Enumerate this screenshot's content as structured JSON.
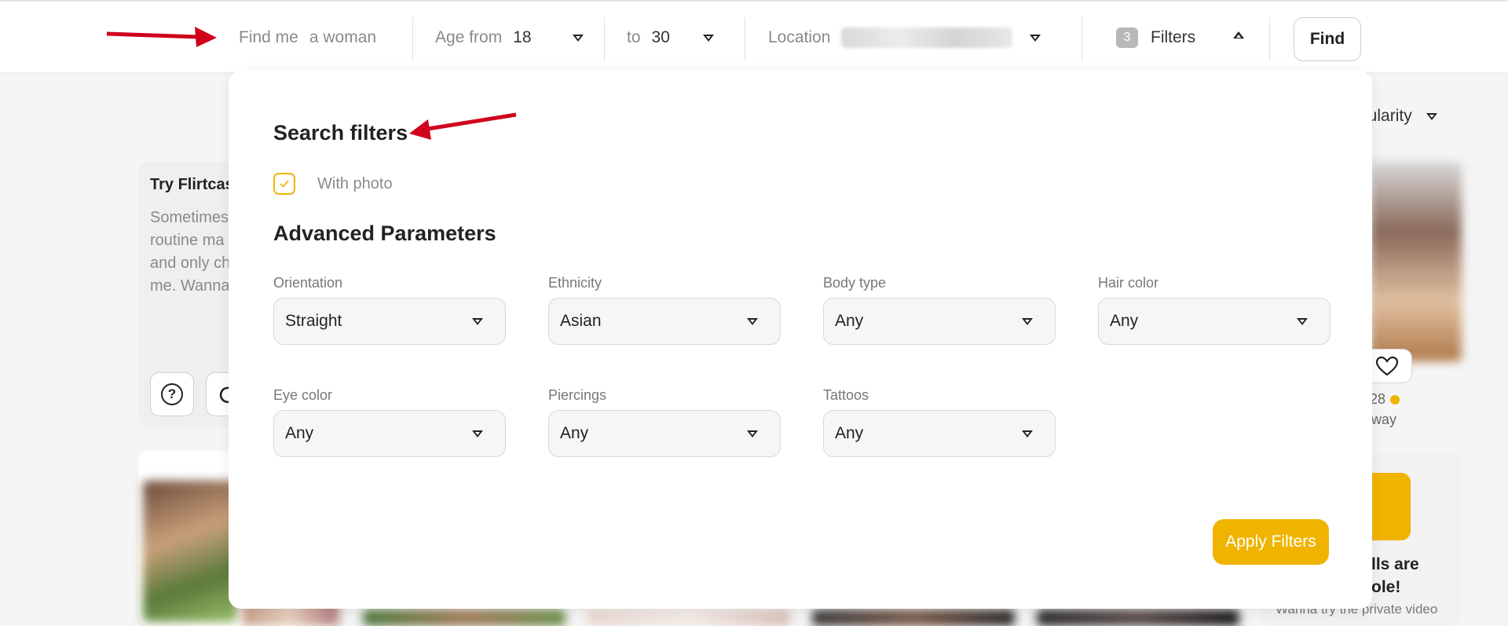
{
  "search_bar": {
    "find_me_label": "Find me",
    "find_me_value": "a woman",
    "age_from_label": "Age from",
    "age_from_value": "18",
    "age_to_label": "to",
    "age_to_value": "30",
    "location_label": "Location",
    "filters_count": "3",
    "filters_label": "Filters",
    "find_button": "Find"
  },
  "background": {
    "sort_label": "pularity",
    "promo": {
      "title": "Try Flirtcas",
      "text": "Sometimes routine ma and only ch me. Wanna"
    },
    "profile_age": "28",
    "profile_distance": "way",
    "video_promo": {
      "title_line1": "lls are",
      "title_line2": "ole!",
      "text": "Wanna try the private video"
    }
  },
  "filter_panel": {
    "title": "Search filters",
    "with_photo_label": "With photo",
    "with_photo_checked": true,
    "advanced_title": "Advanced Parameters",
    "fields": [
      {
        "label": "Orientation",
        "value": "Straight"
      },
      {
        "label": "Ethnicity",
        "value": "Asian"
      },
      {
        "label": "Body type",
        "value": "Any"
      },
      {
        "label": "Hair color",
        "value": "Any"
      },
      {
        "label": "Eye color",
        "value": "Any"
      },
      {
        "label": "Piercings",
        "value": "Any"
      },
      {
        "label": "Tattoos",
        "value": "Any"
      }
    ],
    "apply_button": "Apply Filters"
  },
  "colors": {
    "accent": "#f0b400",
    "annotation_arrow": "#d0021b"
  },
  "icons": [
    "chevron-down-icon",
    "chevron-up-icon",
    "check-icon",
    "help-icon",
    "refresh-icon",
    "heart-icon",
    "red-arrow-annotation"
  ]
}
